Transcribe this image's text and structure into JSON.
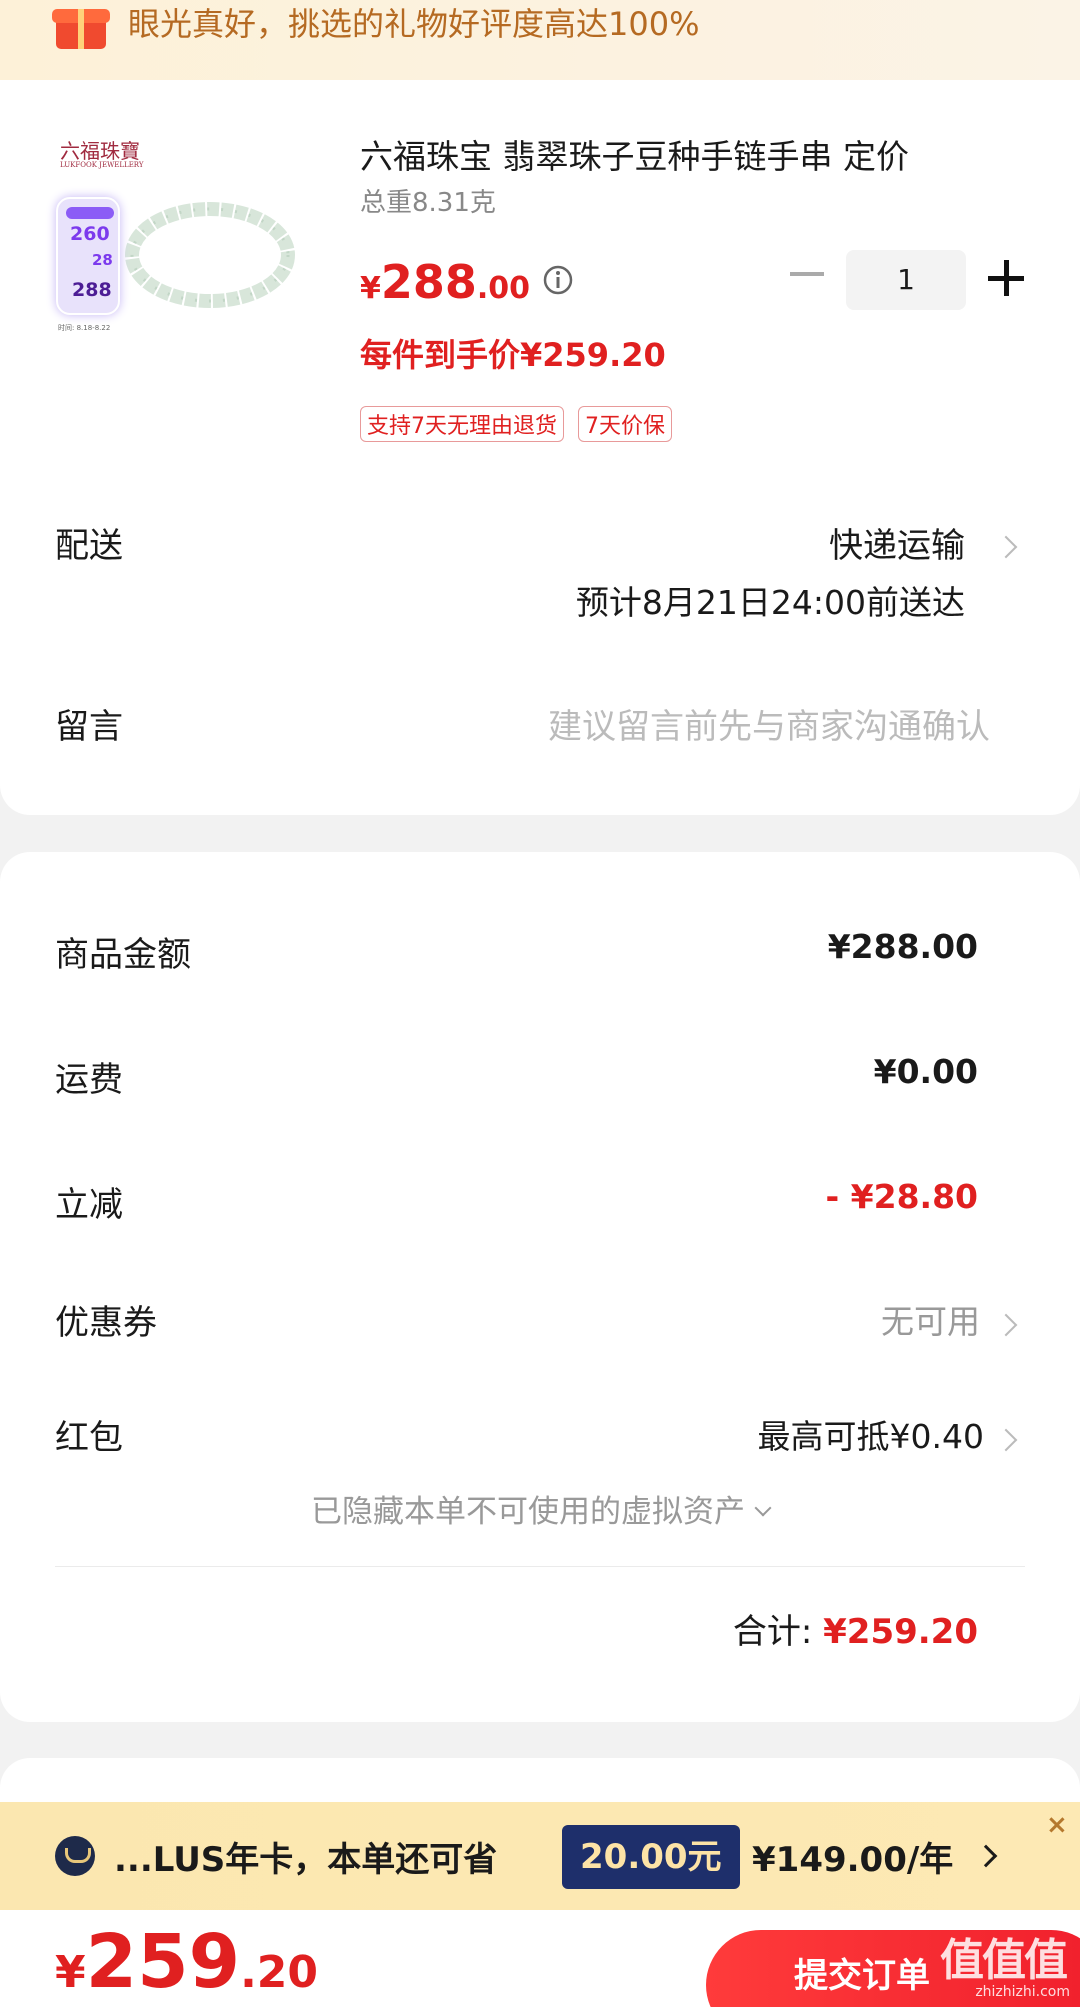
{
  "banner": {
    "text": "眼光真好，挑选的礼物好评度高达100%"
  },
  "product": {
    "brand_logo": "六福珠寶",
    "brand_sub": "LUKFOOK JEWELLERY",
    "promo_a": "260",
    "promo_b": "28",
    "promo_c": "288",
    "promo_foot": "时间: 8.18-8.22",
    "title": "六福珠宝 翡翠珠子豆种手链手串 定价",
    "weight": "总重8.31克",
    "price_currency": "¥",
    "price_int": "288",
    "price_dec": ".00",
    "quantity": "1",
    "final_price": "每件到手价¥259.20",
    "tags": [
      "支持7天无理由退货",
      "7天价保"
    ]
  },
  "shipping": {
    "label": "配送",
    "method": "快递运输",
    "eta": "预计8月21日24:00前送达"
  },
  "message": {
    "label": "留言",
    "placeholder": "建议留言前先与商家沟通确认"
  },
  "summary": {
    "goods_label": "商品金额",
    "goods_value": "¥288.00",
    "freight_label": "运费",
    "freight_value": "¥0.00",
    "discount_label": "立减",
    "discount_value": "- ¥28.80",
    "coupon_label": "优惠券",
    "coupon_value": "无可用",
    "redpacket_label": "红包",
    "redpacket_value": "最高可抵¥0.40",
    "hidden_assets": "已隐藏本单不可使用的虚拟资产",
    "total_label": "合计:",
    "total_value": "¥259.20"
  },
  "plus_bar": {
    "text": "...LUS年卡，本单还可省",
    "save": "20.00元",
    "price": "¥149.00/年",
    "close": "×"
  },
  "bottom": {
    "currency": "¥",
    "price_int": "259",
    "price_dec": ".20",
    "submit": "提交订单"
  },
  "watermark": {
    "main": "值值值",
    "sub": "zhizhizhi.com"
  },
  "colors": {
    "accent_red": "#e02020",
    "plus_navy": "#1e2f6b",
    "banner_brown": "#b56a22"
  }
}
